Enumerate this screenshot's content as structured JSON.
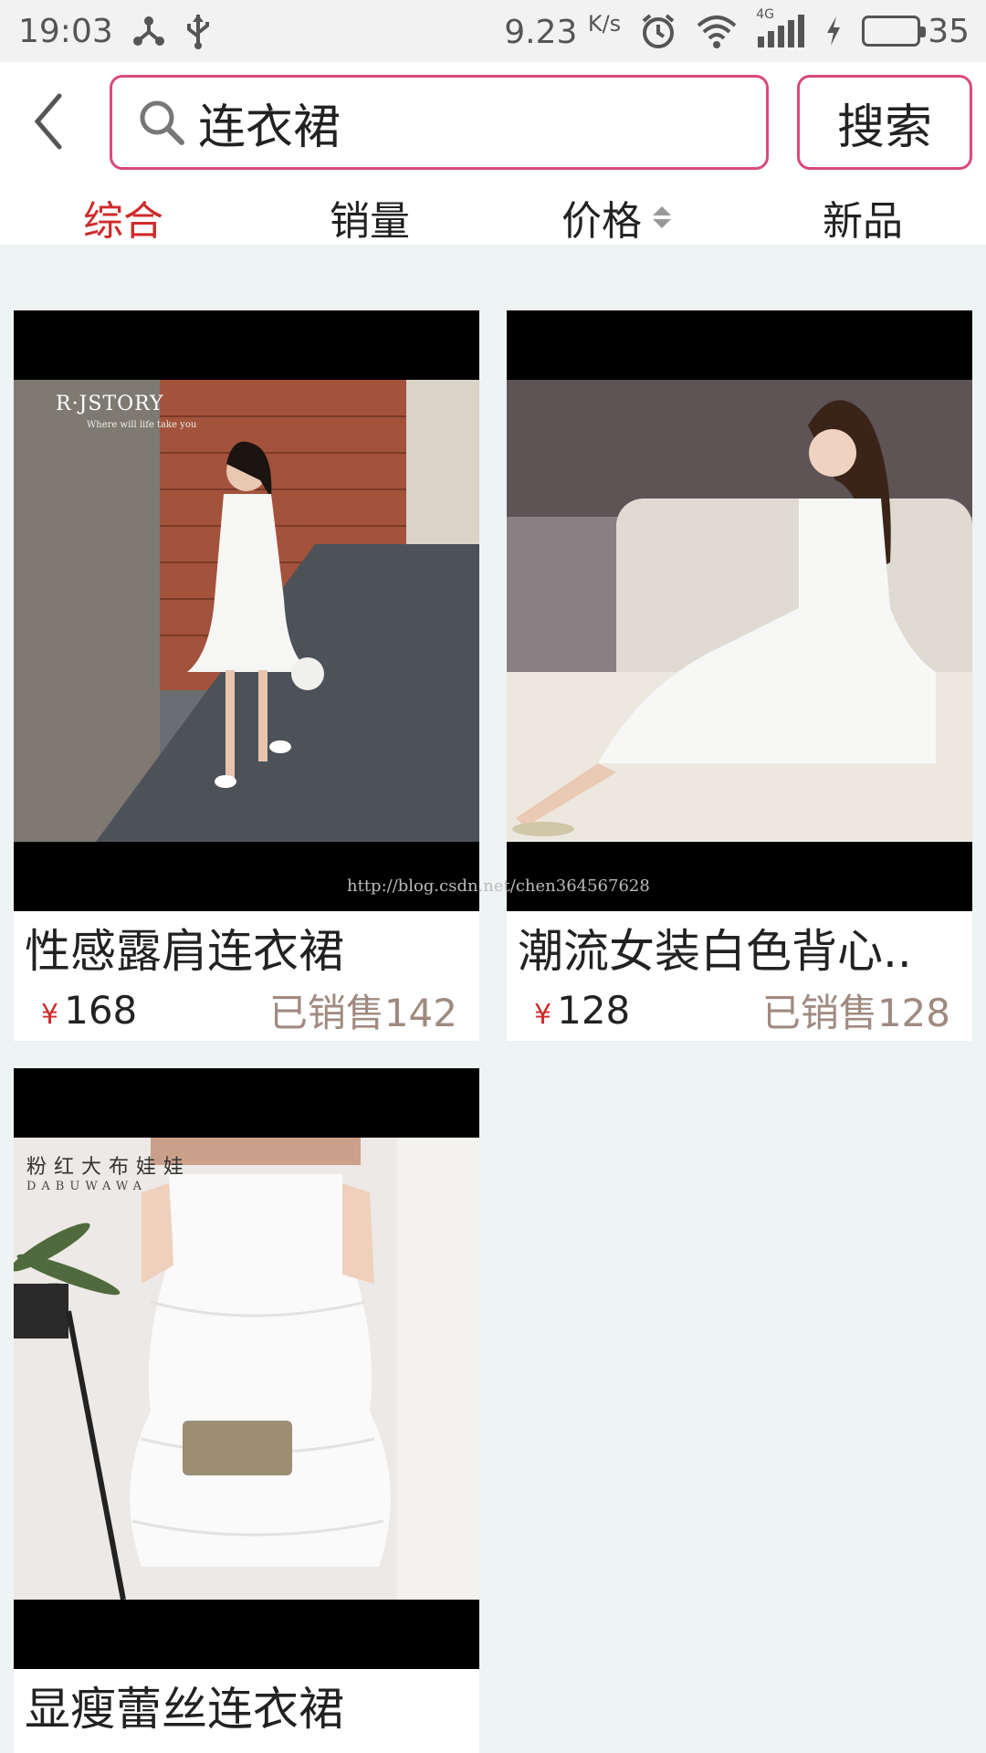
{
  "status_bar": {
    "time": "19:03",
    "net_speed": "9.23",
    "net_unit": "K/s",
    "network_type": "4G",
    "battery": "35",
    "battery_level": 0.35,
    "battery_color": "#27c52b"
  },
  "search": {
    "query": "连衣裙",
    "button_label": "搜索",
    "accent_color": "#d94a7b"
  },
  "sort_tabs": [
    {
      "label": "综合",
      "active": true
    },
    {
      "label": "销量",
      "active": false
    },
    {
      "label": "价格",
      "active": false,
      "has_sort_arrows": true
    },
    {
      "label": "新品",
      "active": false
    }
  ],
  "products": [
    {
      "name": "性感露肩连衣裙",
      "currency": "¥",
      "price": "168",
      "sold": "已销售142",
      "image_brand": "R·JSTORY",
      "image_tagline": "Where will life take you"
    },
    {
      "name": "潮流女装白色背心..",
      "currency": "¥",
      "price": "128",
      "sold": "已销售128"
    },
    {
      "name": "显瘦蕾丝连衣裙",
      "image_brand": "粉红大布娃娃",
      "image_brand_sub": "DABUWAWA"
    }
  ],
  "watermark": "http://blog.csdn.net/chen364567628",
  "colors": {
    "active_tab": "#cf2a2a",
    "currency": "#cf2a2a",
    "sold_text": "#a08a80",
    "page_bg": "#eef3f4"
  }
}
